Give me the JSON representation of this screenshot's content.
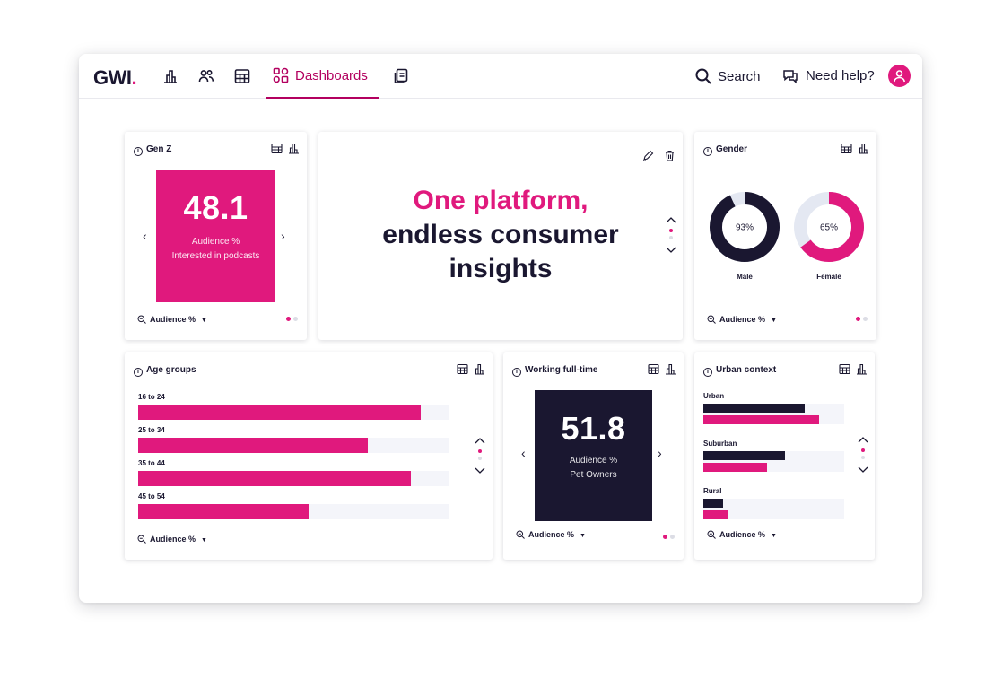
{
  "app": {
    "logo_text": "GWI",
    "logo_dot": ".",
    "nav_active_label": "Dashboards",
    "search_label": "Search",
    "help_label": "Need help?",
    "brand_color": "#e0197d",
    "active_color": "#b3005f",
    "dark_color": "#1a1730"
  },
  "cards": {
    "genz": {
      "title": "Gen Z",
      "value": "48.1",
      "metric": "Audience %",
      "desc": "Interested in podcasts",
      "footer_metric": "Audience %"
    },
    "hero": {
      "line1": "One platform,",
      "line2": "endless consumer",
      "line3": "insights"
    },
    "gender": {
      "title": "Gender",
      "footer_metric": "Audience %",
      "items": [
        {
          "label": "Male",
          "value": 93,
          "value_text": "93%",
          "color": "#1a1730"
        },
        {
          "label": "Female",
          "value": 65,
          "value_text": "65%",
          "color": "#e0197d"
        }
      ]
    },
    "age": {
      "title": "Age groups",
      "footer_metric": "Audience %",
      "rows": [
        {
          "label": "16 to 24",
          "value": 0.91
        },
        {
          "label": "25 to 34",
          "value": 0.74
        },
        {
          "label": "35 to 44",
          "value": 0.88
        },
        {
          "label": "45 to 54",
          "value": 0.55
        }
      ]
    },
    "working": {
      "title": "Working full-time",
      "value": "51.8",
      "metric": "Audience %",
      "desc": "Pet Owners",
      "footer_metric": "Audience %"
    },
    "urban": {
      "title": "Urban context",
      "footer_metric": "Audience %",
      "rows": [
        {
          "label": "Urban",
          "dark": 0.72,
          "pink": 0.82
        },
        {
          "label": "Suburban",
          "dark": 0.58,
          "pink": 0.45
        },
        {
          "label": "Rural",
          "dark": 0.14,
          "pink": 0.18
        }
      ]
    }
  }
}
